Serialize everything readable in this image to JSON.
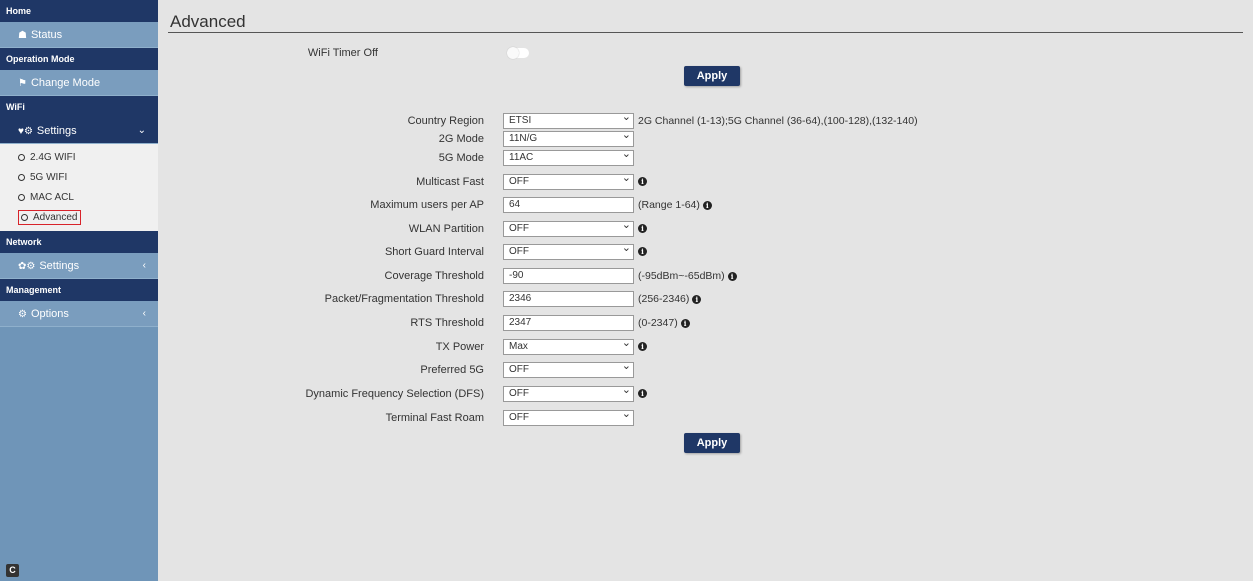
{
  "sidebar": {
    "home": "Home",
    "status": "Status",
    "operation_mode": "Operation Mode",
    "change_mode": "Change Mode",
    "wifi": "WiFi",
    "wifi_settings": "Settings",
    "wifi_sub": [
      "2.4G WIFI",
      "5G WIFI",
      "MAC ACL",
      "Advanced"
    ],
    "network": "Network",
    "network_settings": "Settings",
    "management": "Management",
    "options": "Options",
    "collapse": "C"
  },
  "page": {
    "title": "Advanced",
    "wifi_timer_label": "WiFi Timer Off",
    "apply_top": "Apply",
    "apply_bottom": "Apply"
  },
  "form": {
    "country_region": {
      "label": "Country Region",
      "value": "ETSI",
      "hint": "2G Channel (1-13);5G Channel (36-64),(100-128),(132-140)"
    },
    "mode_2g": {
      "label": "2G Mode",
      "value": "11N/G"
    },
    "mode_5g": {
      "label": "5G Mode",
      "value": "11AC"
    },
    "multicast_fast": {
      "label": "Multicast Fast",
      "value": "OFF"
    },
    "max_users": {
      "label": "Maximum users per AP",
      "value": "64",
      "hint": "(Range 1-64)"
    },
    "wlan_partition": {
      "label": "WLAN Partition",
      "value": "OFF"
    },
    "short_guard": {
      "label": "Short Guard Interval",
      "value": "OFF"
    },
    "coverage": {
      "label": "Coverage Threshold",
      "value": "-90",
      "hint": "(-95dBm~-65dBm)"
    },
    "packet_frag": {
      "label": "Packet/Fragmentation Threshold",
      "value": "2346",
      "hint": "(256-2346)"
    },
    "rts": {
      "label": "RTS Threshold",
      "value": "2347",
      "hint": "(0-2347)"
    },
    "tx_power": {
      "label": "TX Power",
      "value": "Max"
    },
    "preferred_5g": {
      "label": "Preferred 5G",
      "value": "OFF"
    },
    "dfs": {
      "label": "Dynamic Frequency Selection (DFS)",
      "value": "OFF"
    },
    "fast_roam": {
      "label": "Terminal Fast Roam",
      "value": "OFF"
    }
  },
  "colors": {
    "nav_dark": "#1f3766",
    "nav_light": "#7a9dbe",
    "highlight": "#d8232a"
  }
}
